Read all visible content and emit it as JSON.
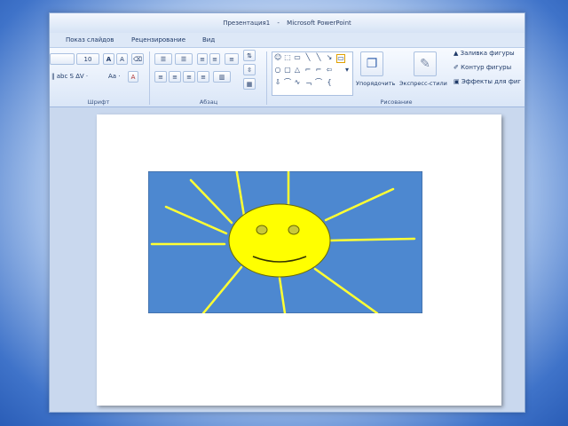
{
  "window": {
    "title_doc": "Презентация1",
    "title_app": "Microsoft PowerPoint"
  },
  "tabs": [
    "Показ слайдов",
    "Рецензирование",
    "Вид"
  ],
  "ribbon": {
    "font_size": "10",
    "aa_label": "Aa",
    "groups": {
      "font": "Шрифт",
      "paragraph": "Абзац",
      "drawing": "Рисование"
    },
    "arrange_label": "Упорядочить",
    "quick_styles_label": "Экспресс-стили",
    "shape_fill": "Заливка фигуры",
    "shape_outline": "Контур фигуры",
    "shape_effects": "Эффекты для фиг"
  },
  "slide": {
    "background_color": "#ffffff",
    "picture": {
      "sky_color": "#4d88d0",
      "sun_color": "#ffff00",
      "ray_color": "#ffff33"
    }
  },
  "icons": [
    "font-grow-icon",
    "font-shrink-icon",
    "clear-format-icon",
    "bullets-icon",
    "numbering-icon",
    "align-left-icon",
    "align-center-icon",
    "align-right-icon",
    "justify-icon",
    "shapes-gallery",
    "arrange-icon",
    "quick-styles-icon",
    "fill-icon",
    "outline-icon",
    "effects-icon"
  ]
}
